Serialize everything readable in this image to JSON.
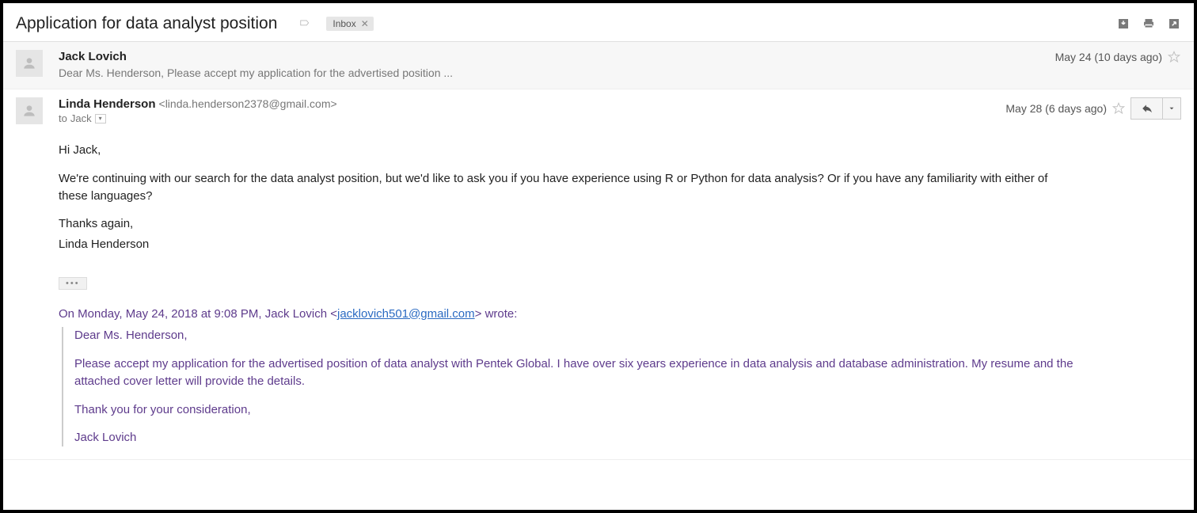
{
  "header": {
    "subject": "Application for data analyst position",
    "label_chip": "Inbox"
  },
  "messages": {
    "collapsed": {
      "sender": "Jack Lovich",
      "snippet": "Dear Ms. Henderson, Please accept my application for the advertised position ...",
      "timestamp": "May 24 (10 days ago)"
    },
    "expanded": {
      "sender": "Linda Henderson",
      "sender_email": "<linda.henderson2378@gmail.com>",
      "to_line_prefix": "to",
      "to_recipient": "Jack",
      "timestamp": "May 28 (6 days ago)",
      "body": {
        "greeting": "Hi Jack,",
        "p1": "We're continuing with our search for the data analyst position, but we'd like to ask you if you have experience using R or Python for data analysis? Or if you have any familiarity with either of these languages?",
        "closing1": "Thanks again,",
        "closing2": "Linda Henderson"
      },
      "quote_header_pre": "On Monday, May 24, 2018 at 9:08 PM, Jack Lovich <",
      "quote_header_email": "jacklovich501@gmail.com",
      "quote_header_post": "> wrote:",
      "quoted": {
        "greeting": "Dear Ms. Henderson,",
        "p1": "Please accept my application for the advertised position of data analyst with Pentek Global. I have over six years experience in data analysis and database administration. My resume and the attached cover letter will provide the details.",
        "closing1": "Thank you for your consideration,",
        "closing2": "Jack Lovich"
      }
    }
  },
  "icons": {
    "ellipsis": "•••"
  }
}
